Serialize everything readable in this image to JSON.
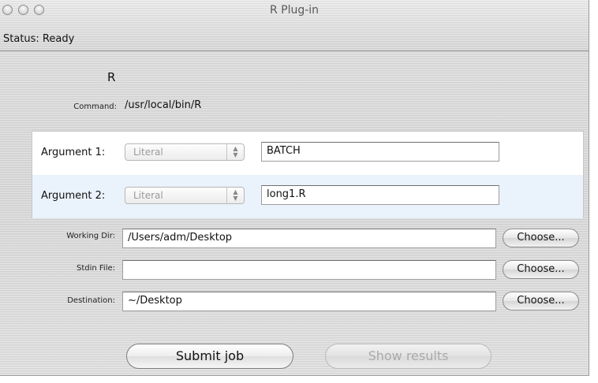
{
  "window": {
    "title": "R Plug-in"
  },
  "status": {
    "text": "Status:  Ready"
  },
  "plugin": {
    "name": "R",
    "command_label": "Command:",
    "command_value": "/usr/local/bin/R"
  },
  "arguments": [
    {
      "label": "Argument 1:",
      "type": "Literal",
      "value": "BATCH"
    },
    {
      "label": "Argument 2:",
      "type": "Literal",
      "value": "long1.R"
    }
  ],
  "files": {
    "working_dir": {
      "label": "Working Dir:",
      "value": "/Users/adm/Desktop",
      "button": "Choose..."
    },
    "stdin_file": {
      "label": "Stdin File:",
      "value": "",
      "button": "Choose..."
    },
    "destination": {
      "label": "Destination:",
      "value": "~/Desktop",
      "button": "Choose..."
    }
  },
  "actions": {
    "submit": "Submit job",
    "show_results": "Show results"
  }
}
